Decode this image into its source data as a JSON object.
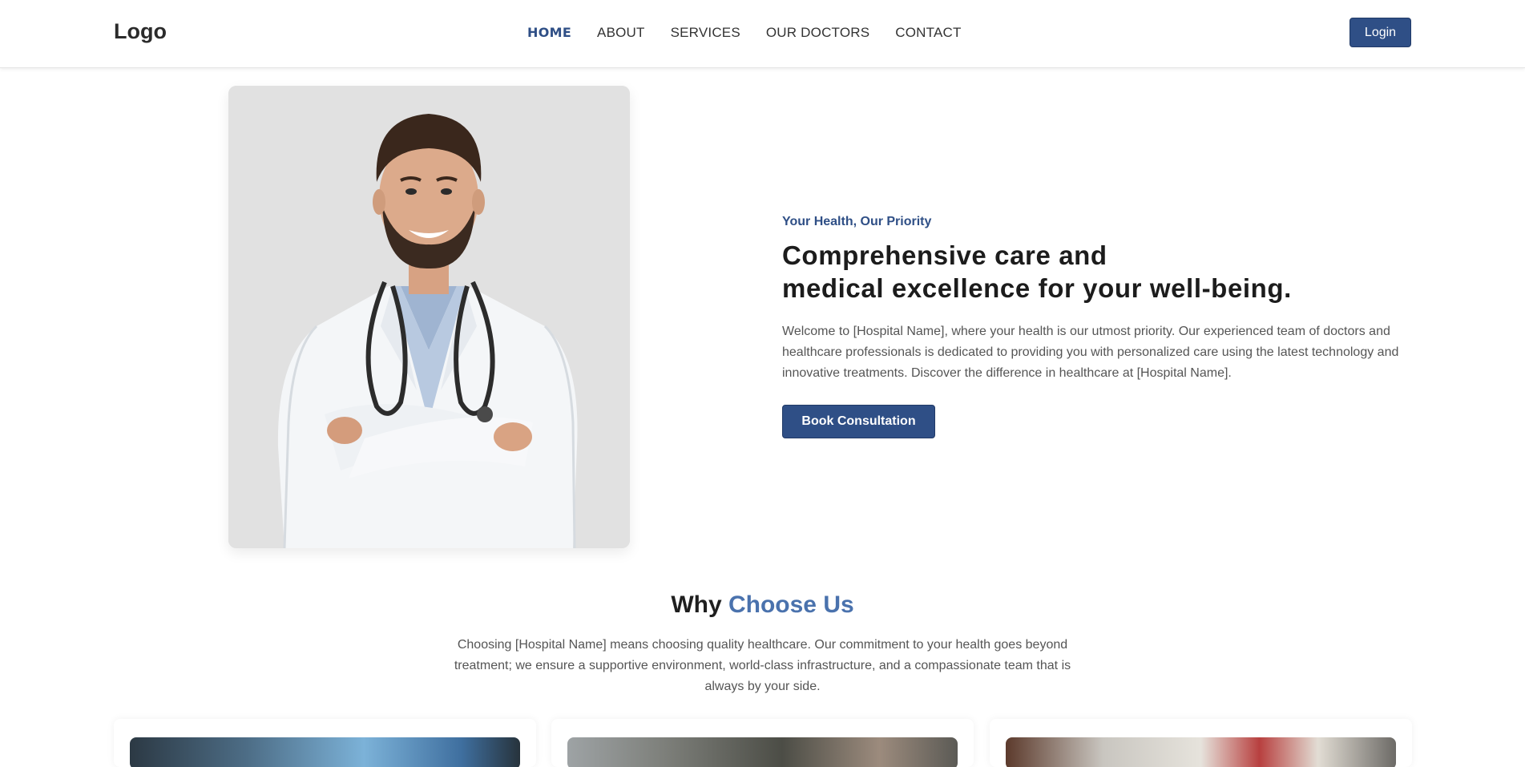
{
  "header": {
    "logo": "Logo",
    "nav": [
      {
        "label": "HOME",
        "active": true
      },
      {
        "label": "ABOUT",
        "active": false
      },
      {
        "label": "SERVICES",
        "active": false
      },
      {
        "label": "OUR DOCTORS",
        "active": false
      },
      {
        "label": "CONTACT",
        "active": false
      }
    ],
    "login_label": "Login"
  },
  "hero": {
    "eyebrow": "Your Health, Our Priority",
    "title_line1": "Comprehensive care and",
    "title_line2": "medical excellence for your well-being.",
    "description": "Welcome to [Hospital Name], where your health is our utmost priority. Our experienced team of doctors and healthcare professionals is dedicated to providing you with personalized care using the latest technology and innovative treatments. Discover the difference in healthcare at [Hospital Name].",
    "cta_label": "Book Consultation"
  },
  "why": {
    "title_plain": "Why",
    "title_accent": "Choose Us",
    "description": "Choosing [Hospital Name] means choosing quality healthcare. Our commitment to your health goes beyond treatment; we ensure a supportive environment, world-class infrastructure, and a compassionate team that is always by your side."
  },
  "colors": {
    "primary": "#2f4f86",
    "accent": "#4a72ad",
    "text": "#1c1c1c",
    "muted": "#555555"
  }
}
